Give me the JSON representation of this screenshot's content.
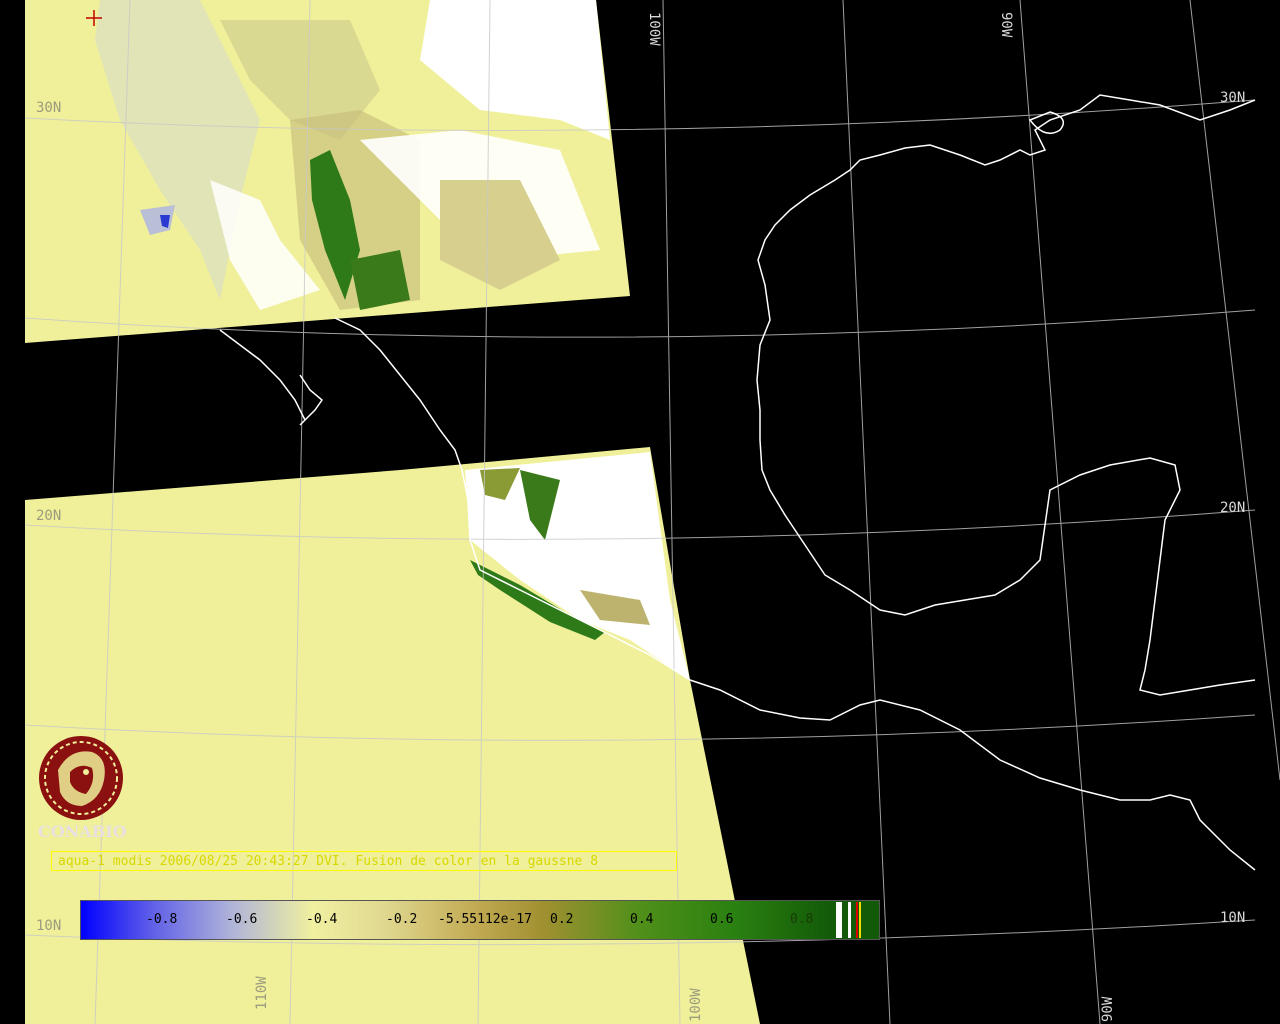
{
  "map": {
    "lat_labels": [
      "30N",
      "20N",
      "10N"
    ],
    "lon_labels_top": [
      "100W",
      "90W"
    ],
    "lon_labels_bottom": [
      "110W",
      "100W",
      "90W"
    ],
    "land_color": "#f0f09a",
    "coast_color": "#ffffff",
    "vegetation_color": "#2e8010"
  },
  "logo": {
    "text": "CONABIO",
    "color": "#8b1010"
  },
  "title": "aqua-1 modis 2006/08/25 20:43:27 DVI. Fusion de color en la gaussne 8",
  "colorbar": {
    "ticks": [
      "-0.8",
      "-0.6",
      "-0.4",
      "-0.2",
      "-5.55112e-17",
      "0.2",
      "0.4",
      "0.6",
      "0.8"
    ],
    "min": -1,
    "max": 1
  }
}
